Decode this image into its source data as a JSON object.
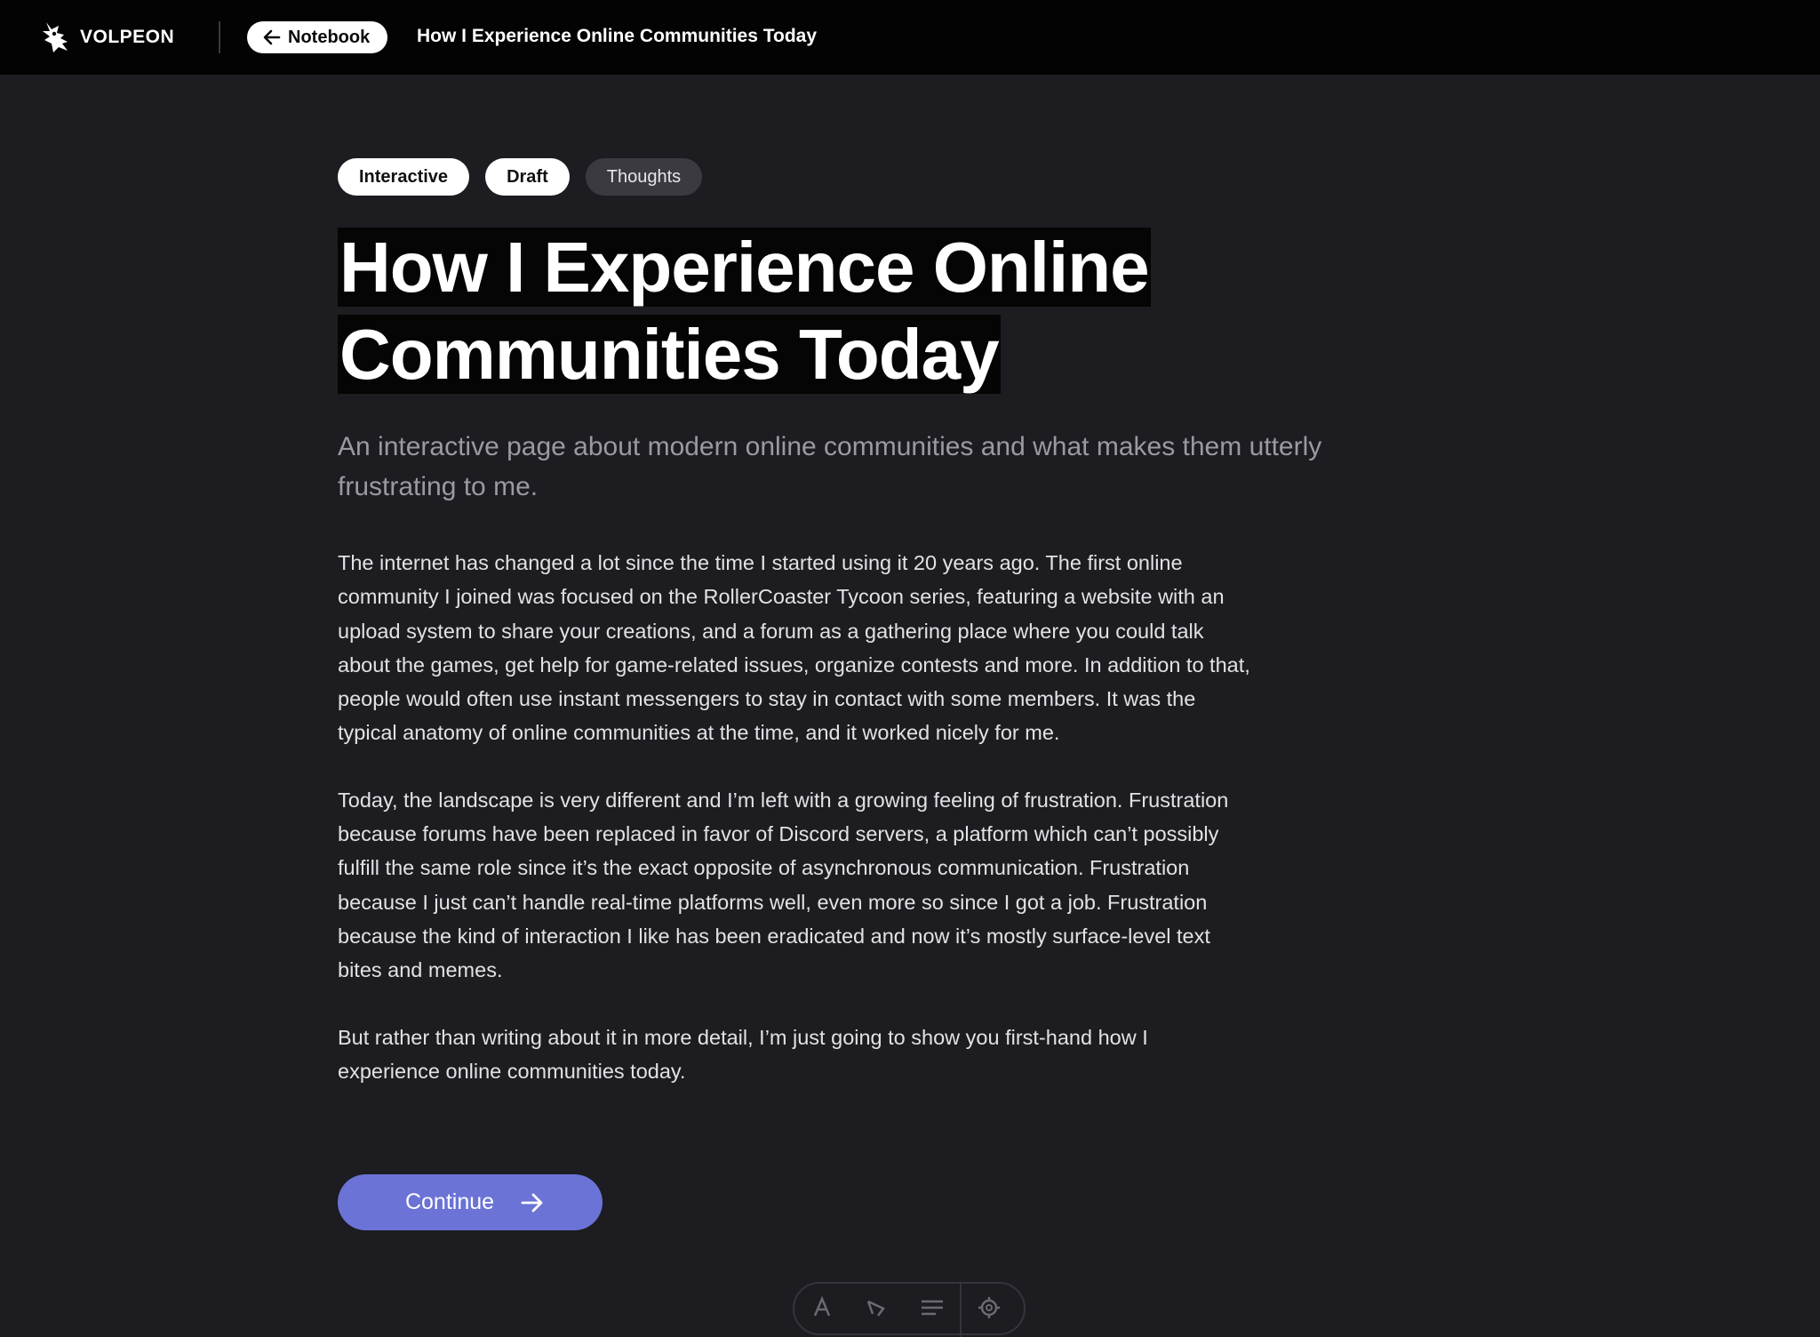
{
  "brand": {
    "name": "VOLPEON",
    "logo_icon": "fox-logo-icon"
  },
  "nav": {
    "back_label": "Notebook",
    "back_icon": "arrow-left-icon",
    "page_title": "How I Experience Online Communities Today"
  },
  "tags": [
    {
      "label": "Interactive",
      "style": "light"
    },
    {
      "label": "Draft",
      "style": "light"
    },
    {
      "label": "Thoughts",
      "style": "dark"
    }
  ],
  "article": {
    "title_line1": "How I Experience Online",
    "title_line2": "Communities Today",
    "subtitle": "An interactive page about modern online communities and what makes them utterly frustrating to me.",
    "paragraphs": [
      "The internet has changed a lot since the time I started using it 20 years ago. The first online community I joined was focused on the RollerCoaster Tycoon series, featuring a website with an upload system to share your creations, and a forum as a gathering place where you could talk about the games, get help for game-related issues, organize contests and more. In addition to that, people would often use instant messengers to stay in contact with some members. It was the typical anatomy of online communities at the time, and it worked nicely for me.",
      "Today, the landscape is very different and I’m left with a growing feeling of frustration. Frustration because forums have been replaced in favor of Discord servers, a platform which can’t possibly fulfill the same role since it’s the exact opposite of asynchronous communication. Frustration because I just can’t handle real-time platforms well, even more so since I got a job. Frustration because the kind of interaction I like has been eradicated and now it’s mostly surface-level text bites and memes.",
      "But rather than writing about it in more detail, I’m just going to show you first-hand how I experience online communities today."
    ],
    "continue_label": "Continue",
    "continue_icon": "arrow-right-icon"
  },
  "toolbar": {
    "tools": [
      "font-size-icon",
      "highlight-icon",
      "text-align-icon",
      "settings-icon"
    ]
  },
  "colors": {
    "background": "#1c1c21",
    "topbar": "#030303",
    "accent": "#6b73d6",
    "muted_text": "#9a9aa2"
  }
}
